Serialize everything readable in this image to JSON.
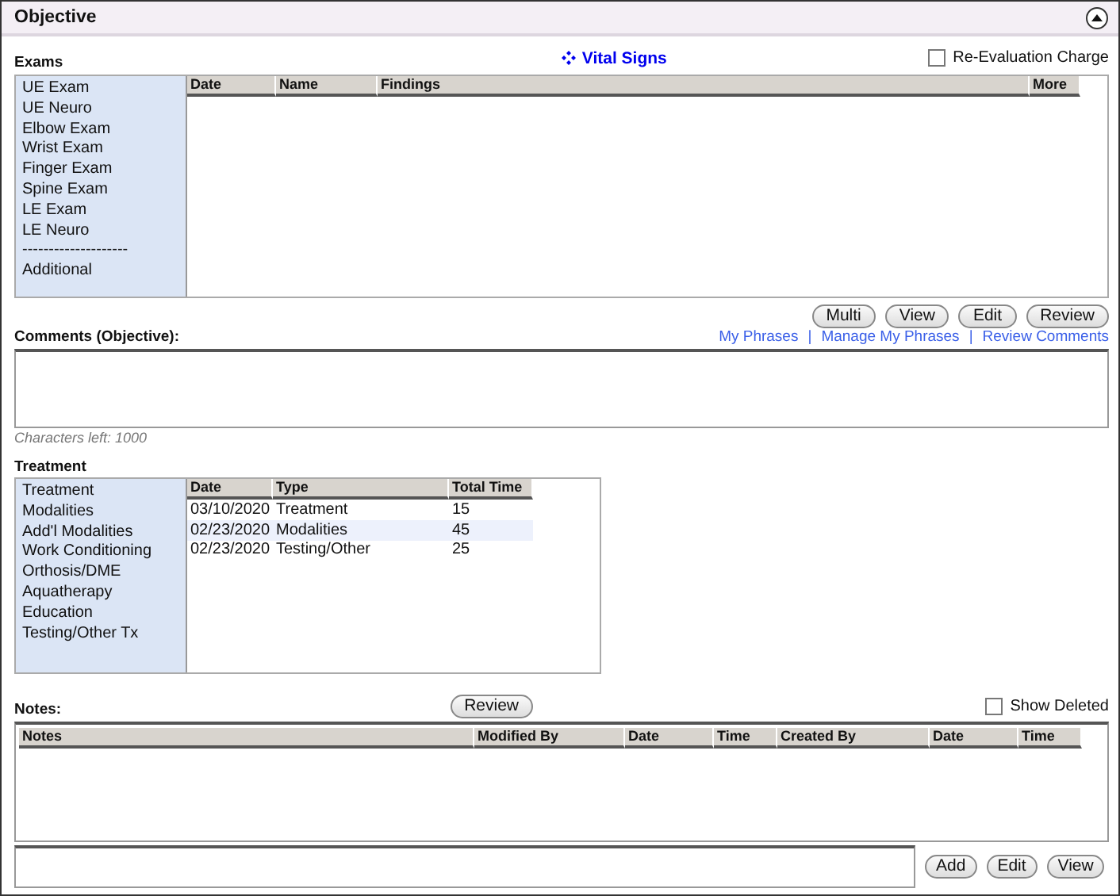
{
  "panel": {
    "title": "Objective",
    "expanded": true
  },
  "exams": {
    "label": "Exams",
    "vital_signs": "Vital Signs",
    "re_evaluation": {
      "label": "Re-Evaluation Charge",
      "checked": false
    },
    "items": [
      "UE Exam",
      "UE Neuro",
      "Elbow Exam",
      "Wrist Exam",
      "Finger Exam",
      "Spine Exam",
      "LE Exam",
      "LE Neuro",
      "--------------------",
      "Additional"
    ],
    "columns": [
      "Date",
      "Name",
      "Findings",
      "More"
    ],
    "buttons": [
      "Multi",
      "View",
      "Edit",
      "Review"
    ]
  },
  "comments": {
    "label": "Comments (Objective):",
    "links": [
      "My Phrases",
      "Manage My Phrases",
      "Review Comments"
    ],
    "separators": [
      "|",
      "|"
    ],
    "characters_left": "Characters left: 1000"
  },
  "treatment": {
    "label": "Treatment",
    "items": [
      "Treatment",
      "Modalities",
      "Add'l Modalities",
      "Work Conditioning",
      "Orthosis/DME",
      "Aquatherapy",
      "Education",
      "Testing/Other Tx"
    ],
    "columns": [
      "Date",
      "Type",
      "Total Time"
    ],
    "rows": [
      {
        "cells": [
          "03/10/2020",
          "Treatment",
          "15"
        ],
        "selected": false
      },
      {
        "cells": [
          "02/23/2020",
          "Modalities",
          "45"
        ],
        "selected": true
      },
      {
        "cells": [
          "02/23/2020",
          "Testing/Other",
          "25"
        ],
        "selected": false
      }
    ]
  },
  "notes": {
    "label": "Notes:",
    "review": "Review",
    "show_deleted": {
      "label": "Show Deleted",
      "checked": false
    },
    "columns": [
      "Notes",
      "Modified By",
      "Date",
      "Time",
      "Created By",
      "Date",
      "Time"
    ],
    "buttons": [
      "Add",
      "Edit",
      "View"
    ]
  }
}
